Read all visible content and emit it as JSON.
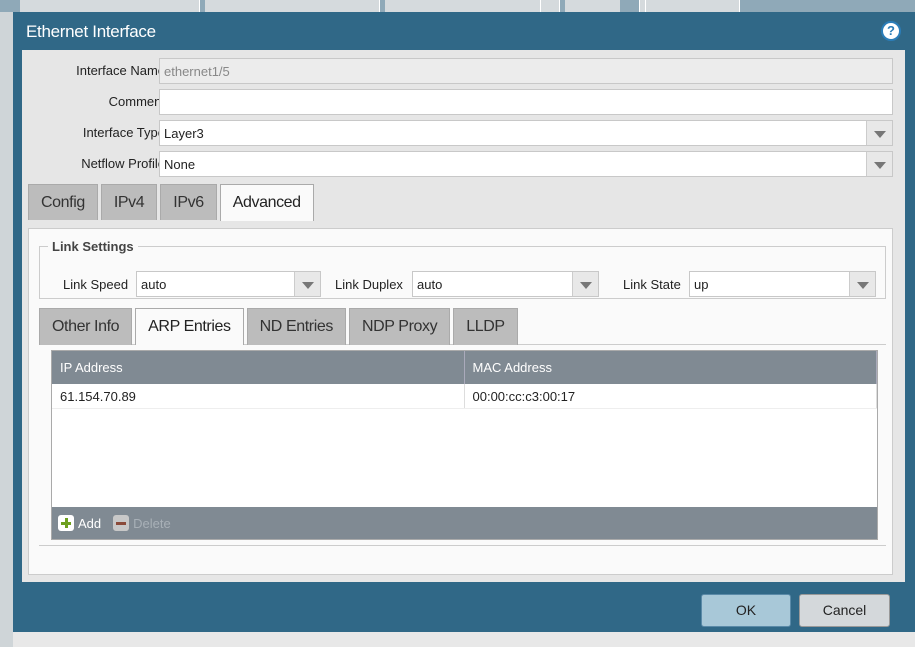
{
  "dialog": {
    "title": "Ethernet Interface",
    "help_icon": "help-icon"
  },
  "fields": {
    "interface_name": {
      "label": "Interface Name",
      "value": "ethernet1/5"
    },
    "comment": {
      "label": "Comment",
      "value": ""
    },
    "interface_type": {
      "label": "Interface Type",
      "value": "Layer3"
    },
    "netflow_profile": {
      "label": "Netflow Profile",
      "value": "None"
    }
  },
  "tabs": [
    "Config",
    "IPv4",
    "IPv6",
    "Advanced"
  ],
  "link_settings": {
    "legend": "Link Settings",
    "speed_label": "Link Speed",
    "speed": "auto",
    "duplex_label": "Link Duplex",
    "duplex": "auto",
    "state_label": "Link State",
    "state": "up"
  },
  "subtabs": [
    "Other Info",
    "ARP Entries",
    "ND Entries",
    "NDP Proxy",
    "LLDP"
  ],
  "arp": {
    "columns": [
      "IP Address",
      "MAC Address"
    ],
    "rows": [
      [
        "61.154.70.89",
        "00:00:cc:c3:00:17"
      ]
    ],
    "add": "Add",
    "delete": "Delete"
  },
  "buttons": {
    "ok": "OK",
    "cancel": "Cancel"
  }
}
